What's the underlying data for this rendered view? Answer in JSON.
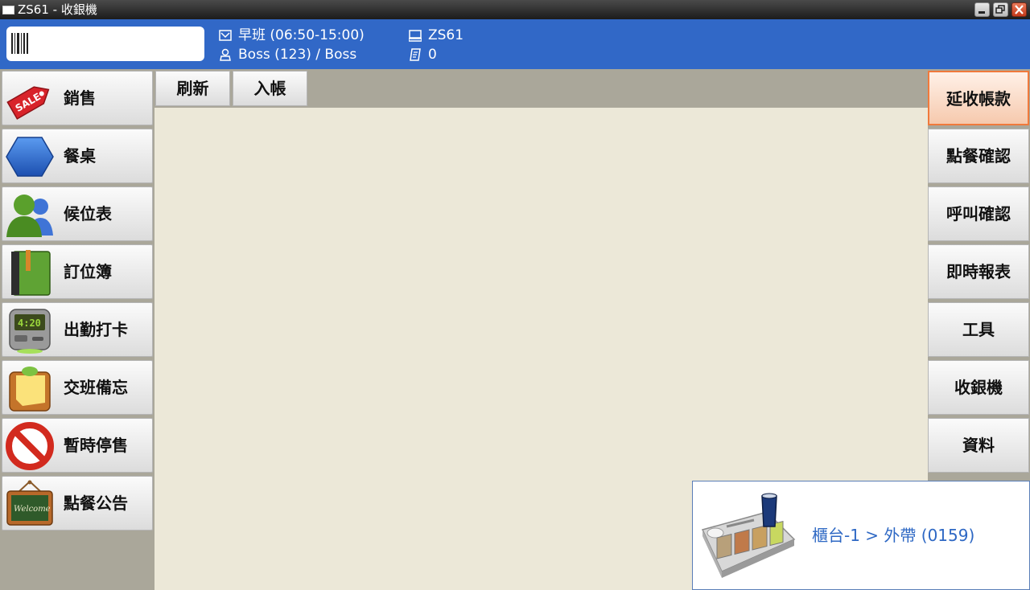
{
  "window": {
    "title": "ZS61 - 收銀機"
  },
  "header": {
    "shift": "早班 (06:50-15:00)",
    "user": "Boss (123) / Boss",
    "terminal": "ZS61",
    "receipt_count": "0",
    "scan_input": {
      "value": "",
      "placeholder": ""
    },
    "icons": [
      "barcode-icon",
      "shift-icon",
      "user-icon",
      "terminal-icon",
      "receipt-icon"
    ]
  },
  "left_nav": [
    {
      "label": "銷售",
      "icon": "sale-tag-icon"
    },
    {
      "label": "餐桌",
      "icon": "table-hexagon-icon"
    },
    {
      "label": "候位表",
      "icon": "people-icon"
    },
    {
      "label": "訂位簿",
      "icon": "book-icon"
    },
    {
      "label": "出勤打卡",
      "icon": "punch-clock-icon"
    },
    {
      "label": "交班備忘",
      "icon": "memo-icon"
    },
    {
      "label": "暫時停售",
      "icon": "prohibited-icon"
    },
    {
      "label": "點餐公告",
      "icon": "welcome-board-icon"
    }
  ],
  "clock_display": "4:20",
  "board_text": "Welcome",
  "sale_tag_text": "SALE",
  "toolbar": {
    "refresh_label": "刷新",
    "post_label": "入帳"
  },
  "right_nav": [
    {
      "label": "延收帳款",
      "active": true
    },
    {
      "label": "點餐確認",
      "active": false
    },
    {
      "label": "呼叫確認",
      "active": false
    },
    {
      "label": "即時報表",
      "active": false
    },
    {
      "label": "工具",
      "active": false
    },
    {
      "label": "收銀機",
      "active": false
    },
    {
      "label": "資料",
      "active": false
    }
  ],
  "order_panel": {
    "text": "櫃台-1 > 外帶 (0159)",
    "icon": "food-tray-icon"
  },
  "colors": {
    "header_bg": "#3168c7",
    "accent_orange": "#f07a3c",
    "order_text": "#2e68c4",
    "workspace_bg": "#ece8d8",
    "sidebar_bg": "#aaa79a"
  }
}
